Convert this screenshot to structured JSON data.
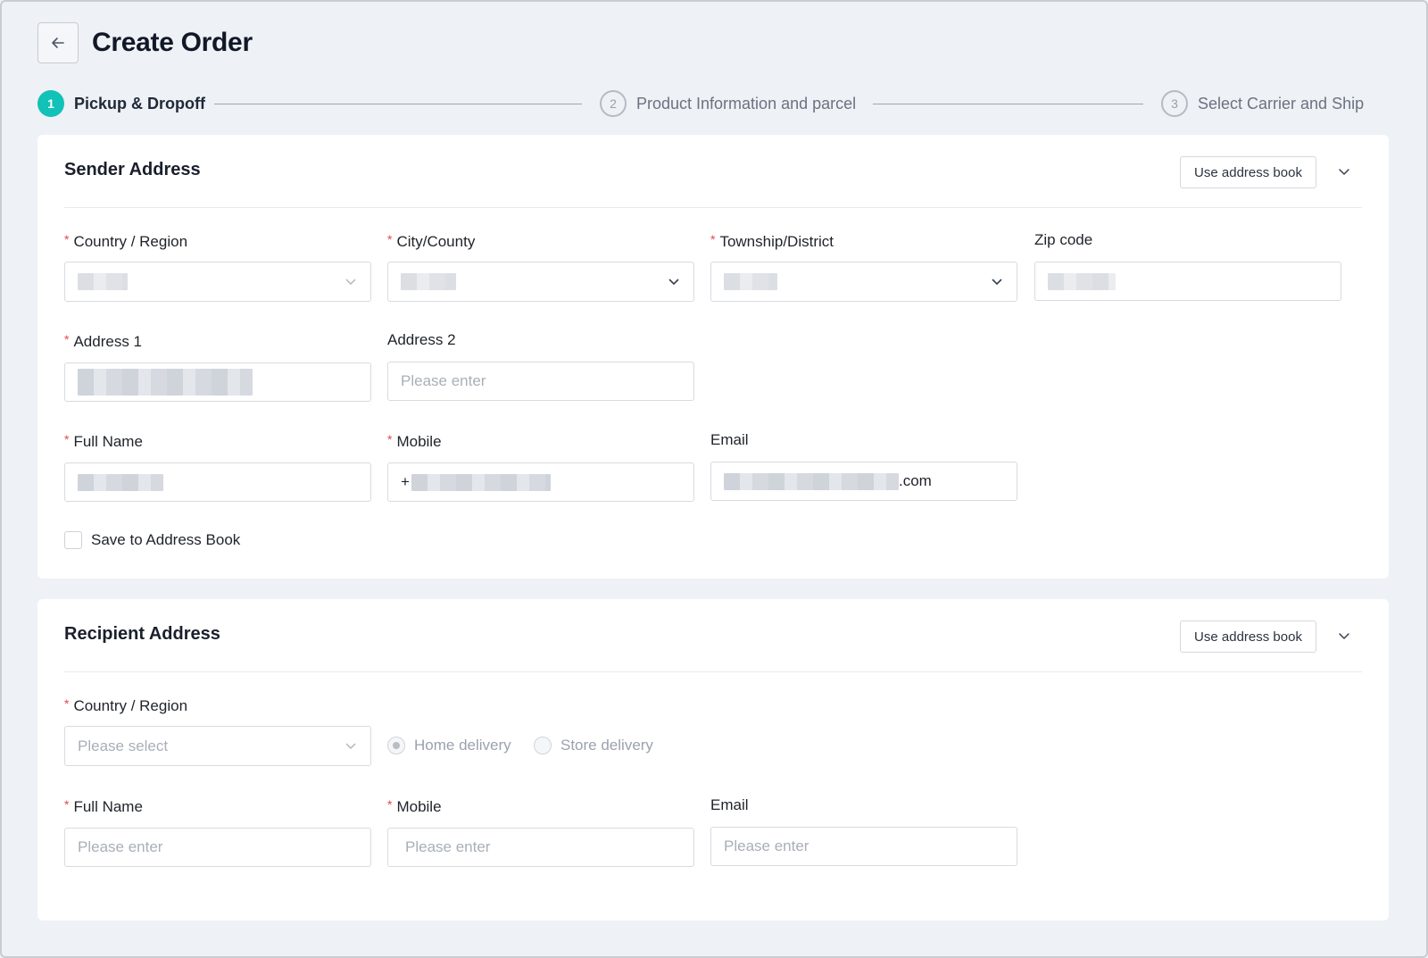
{
  "header": {
    "title": "Create Order"
  },
  "steps": [
    {
      "number": "1",
      "label": "Pickup & Dropoff",
      "active": true
    },
    {
      "number": "2",
      "label": "Product Information and parcel",
      "active": false
    },
    {
      "number": "3",
      "label": "Select Carrier and Ship",
      "active": false
    }
  ],
  "sender": {
    "title": "Sender Address",
    "address_book_label": "Use address book",
    "country_label": "Country / Region",
    "city_label": "City/County",
    "township_label": "Township/District",
    "zip_label": "Zip code",
    "address1_label": "Address 1",
    "address2_label": "Address 2",
    "address2_placeholder": "Please enter",
    "fullname_label": "Full Name",
    "mobile_label": "Mobile",
    "mobile_prefix": "+",
    "email_label": "Email",
    "email_suffix": ".com",
    "save_label": "Save to Address Book"
  },
  "recipient": {
    "title": "Recipient Address",
    "address_book_label": "Use address book",
    "country_label": "Country / Region",
    "country_placeholder": "Please select",
    "home_delivery_label": "Home delivery",
    "store_delivery_label": "Store delivery",
    "fullname_label": "Full Name",
    "fullname_placeholder": "Please enter",
    "mobile_label": "Mobile",
    "mobile_placeholder": "Please enter",
    "email_label": "Email",
    "email_placeholder": "Please enter"
  },
  "required_mark": "*",
  "colors": {
    "accent": "#12c1b7",
    "required": "#e5484d",
    "background": "#eef1f5"
  }
}
